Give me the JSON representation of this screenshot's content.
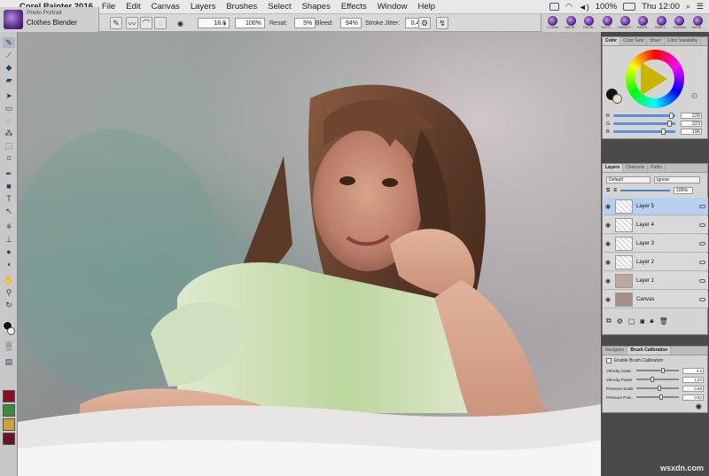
{
  "menubar": {
    "app_name": "Corel Painter 2016",
    "menus": [
      "File",
      "Edit",
      "Canvas",
      "Layers",
      "Brushes",
      "Select",
      "Shapes",
      "Effects",
      "Window",
      "Help"
    ],
    "battery": "100%",
    "clock": "Thu 12:00"
  },
  "brush_selector": {
    "category": "Photo Portrait",
    "variant": "Clothes Blender"
  },
  "property_bar": {
    "size": "18.6",
    "opacity": "100%",
    "resat_label": "Resat:",
    "resat_value": "5%",
    "bleed_label": "Bleed:",
    "bleed_value": "94%",
    "jitter_label": "Stroke Jitter:",
    "jitter_value": "0.40"
  },
  "dab_library": [
    "1-Cloner",
    "Hair Bl...",
    "Fine Bl...",
    "Soft Cl...",
    "Colored P...",
    "Paint B...",
    "Chalk C...",
    "Gouache",
    "Hair Bl...",
    "Fine Bl..."
  ],
  "color_panel": {
    "tabs": [
      "Color",
      "Color Sets",
      "Mixer",
      "Color Variability"
    ],
    "rgb": [
      {
        "label": "R",
        "value": "229",
        "fraction": 0.9
      },
      {
        "label": "G",
        "value": "223",
        "fraction": 0.87
      },
      {
        "label": "B",
        "value": "196",
        "fraction": 0.77
      }
    ]
  },
  "layers_panel": {
    "tabs": [
      "Layers",
      "Channels",
      "Paths"
    ],
    "composite_method": "Default",
    "preserve": "Ignore",
    "opacity": "100%",
    "layers": [
      {
        "name": "Layer 5",
        "selected": true
      },
      {
        "name": "Layer 4",
        "selected": false
      },
      {
        "name": "Layer 3",
        "selected": false
      },
      {
        "name": "Layer 2",
        "selected": false
      },
      {
        "name": "Layer 1",
        "selected": false
      },
      {
        "name": "Canvas",
        "selected": false
      }
    ]
  },
  "calibration_panel": {
    "tabs": [
      "Navigator",
      "Brush Calibration"
    ],
    "enable_label": "Enable Brush Calibration",
    "rows": [
      {
        "label": "Velocity Scale",
        "value": "4.6",
        "fraction": 0.6
      },
      {
        "label": "Velocity Power",
        "value": "1.20",
        "fraction": 0.35
      },
      {
        "label": "Pressure Scale",
        "value": "0.89",
        "fraction": 0.5
      },
      {
        "label": "Pressure Pow...",
        "value": "0.52",
        "fraction": 0.55
      }
    ]
  },
  "watermark": "wsxdn.com"
}
